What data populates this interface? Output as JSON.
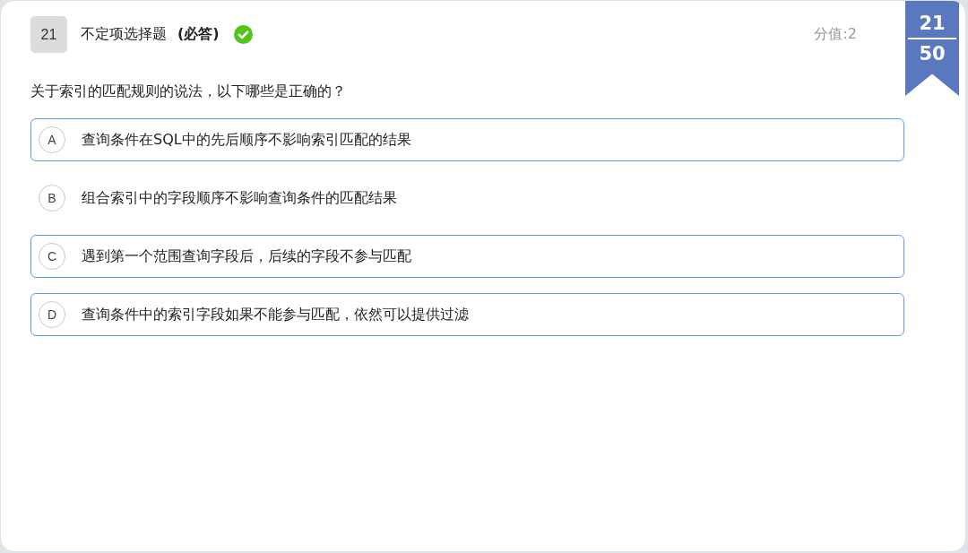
{
  "question": {
    "number": "21",
    "type": "不定项选择题",
    "required_label": "(必答)",
    "answered": true,
    "score": "分值:2",
    "text": "关于索引的匹配规则的说法，以下哪些是正确的？"
  },
  "progress": {
    "current": "21",
    "total": "50"
  },
  "options": [
    {
      "letter": "A",
      "text": "查询条件在SQL中的先后顺序不影响索引匹配的结果",
      "selected": true
    },
    {
      "letter": "B",
      "text": "组合索引中的字段顺序不影响查询条件的匹配结果",
      "selected": false
    },
    {
      "letter": "C",
      "text": "遇到第一个范围查询字段后，后续的字段不参与匹配",
      "selected": true
    },
    {
      "letter": "D",
      "text": "查询条件中的索引字段如果不能参与匹配，依然可以提供过滤",
      "selected": true
    }
  ]
}
